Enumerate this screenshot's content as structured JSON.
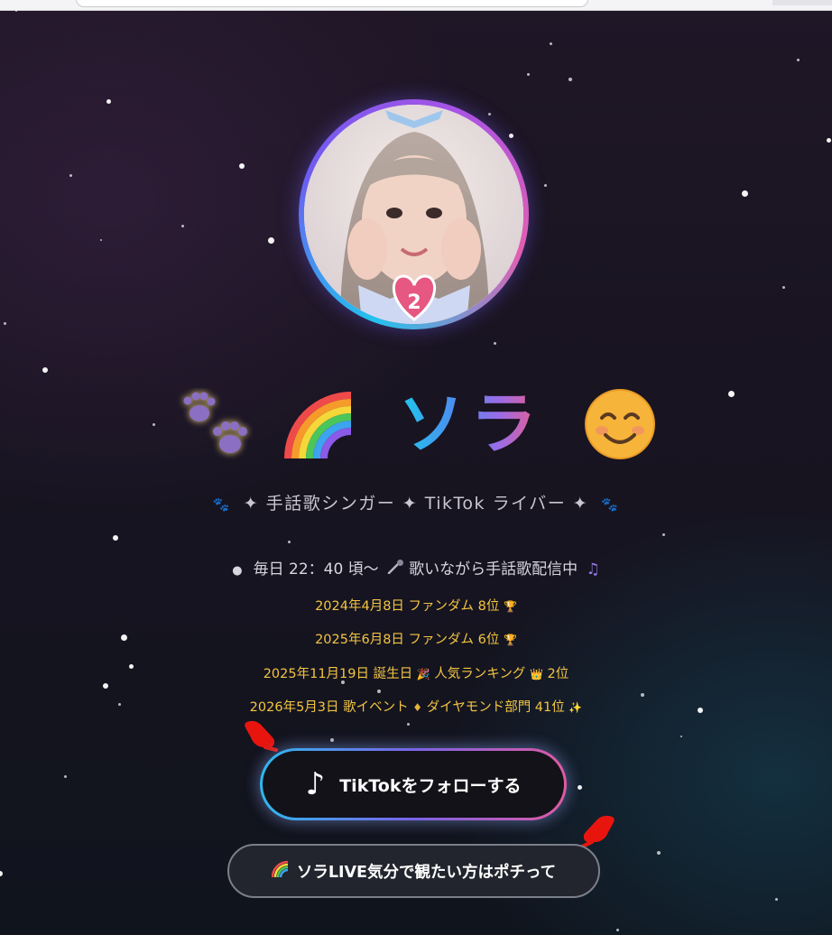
{
  "profile": {
    "avatar_alt": "ソラ",
    "avatar_badge": "2",
    "name": "ソラ",
    "title_icons": [
      "paw-icon",
      "rainbow-icon",
      "smiling-face-icon"
    ]
  },
  "subtitle": "✦ 手話歌シンガー ✦ TikTok ライバー ✦",
  "schedule": {
    "prefix": "毎日 22：40 頃〜",
    "text": "歌いながら手話歌配信中"
  },
  "achievements": [
    {
      "date": "2024年4月8日",
      "text": "ファンダム 8位"
    },
    {
      "date": "2025年6月8日",
      "text": "ファンダム 6位"
    },
    {
      "date": "2025年11月19日",
      "text_a": "誕生日",
      "text_b": "人気ランキング",
      "text_c": "2位"
    },
    {
      "date": "2026年5月3日",
      "text_a": "歌イベント",
      "text_b": "ダイヤモンド部門 41位"
    }
  ],
  "buttons": {
    "tiktok_note": "♪",
    "tiktok_label": "TikTokをフォローする",
    "live_label": "ソラLIVE気分で観たい方はポチって"
  },
  "colors": {
    "accent_cyan": "#22c3ee",
    "accent_purple": "#8a5cf0",
    "accent_pink": "#e25fb0",
    "gold_text": "#f4c542",
    "background": "#181421"
  }
}
